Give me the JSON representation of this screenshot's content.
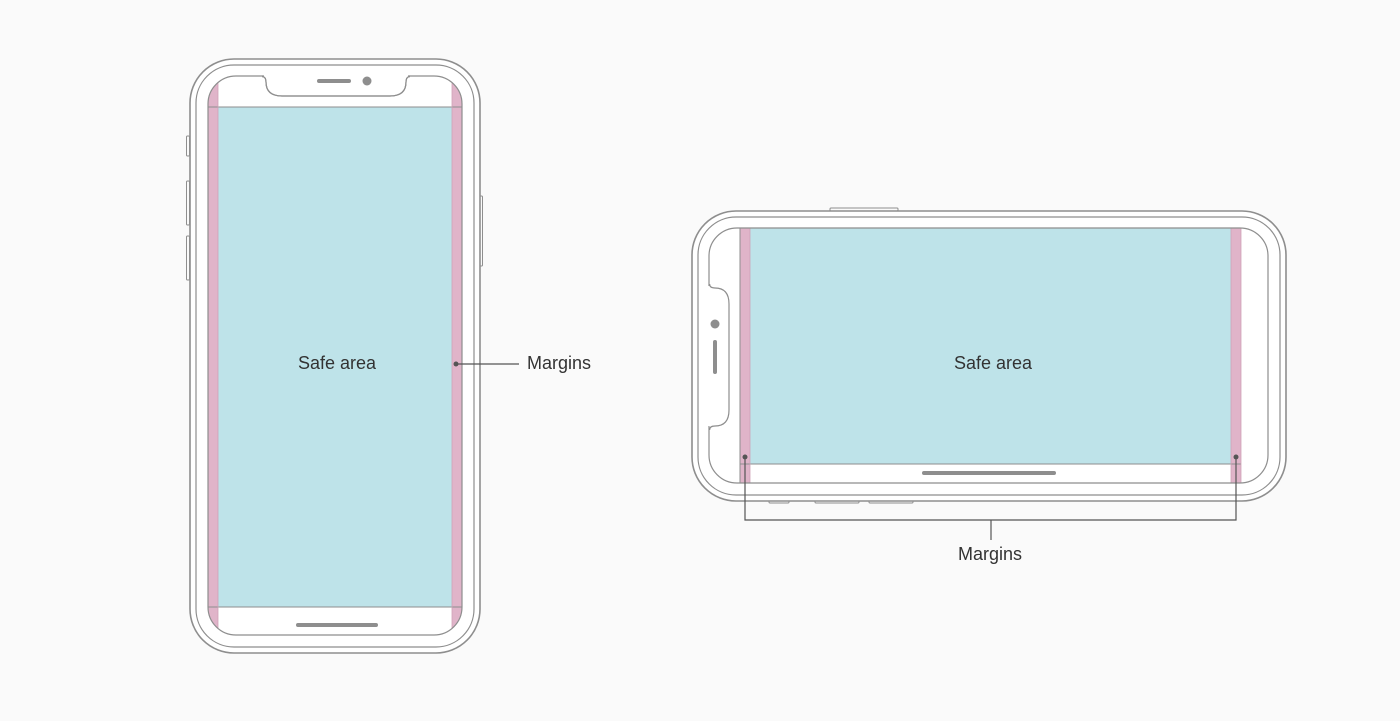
{
  "portrait": {
    "safe_area_label": "Safe area",
    "margins_label": "Margins"
  },
  "landscape": {
    "safe_area_label": "Safe area",
    "margins_label": "Margins"
  },
  "colors": {
    "background": "#fafafa",
    "device_outline": "#8e8e8e",
    "safe_area_fill": "#bee3e9",
    "margin_fill": "#e0b4c9",
    "callout_line": "#555555"
  }
}
